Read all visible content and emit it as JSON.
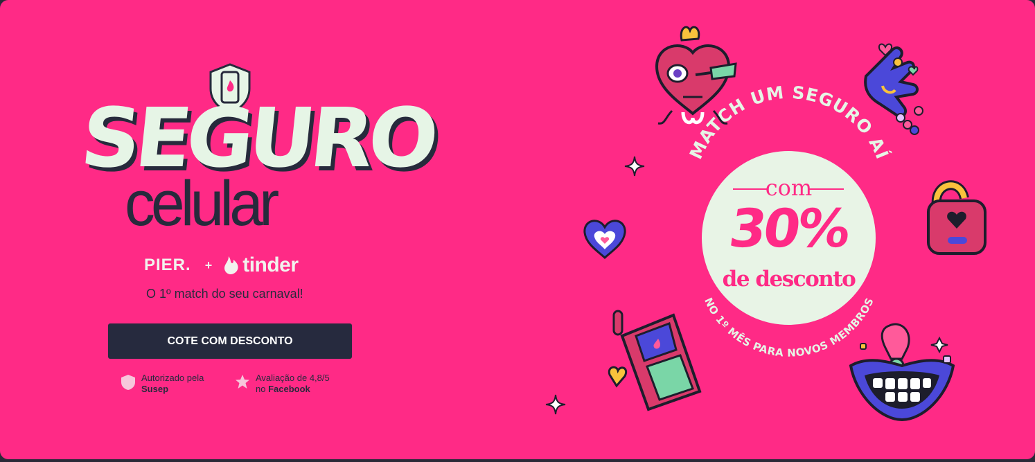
{
  "hero": {
    "title_top": "SEGURO",
    "title_bottom": "celular",
    "brand_pier": "PIER.",
    "brand_plus": "+",
    "brand_tinder": "tinder",
    "tagline": "O 1º match do seu carnaval!",
    "cta_label": "COTE COM DESCONTO"
  },
  "badges": [
    {
      "icon": "shield-icon",
      "line1": "Autorizado pela",
      "line2": "Susep"
    },
    {
      "icon": "star-icon",
      "line1": "Avaliação de 4,8/5",
      "line2_prefix": "no ",
      "line2": "Facebook"
    }
  ],
  "promo": {
    "arc_top": "MATCH UM SEGURO AÍ",
    "com": "com",
    "percent": "30%",
    "desc": "de desconto",
    "arc_bottom": "NO 1º MÊS PARA NOVOS MEMBROS"
  },
  "colors": {
    "background": "#ff2a86",
    "dark": "#262a3e",
    "mint": "#e6f5e6"
  },
  "stickers": [
    "heart-arrow-sticker",
    "hand-gesture-sticker",
    "padlock-sticker",
    "blue-heart-sticker",
    "phone-sticker",
    "lips-sticker",
    "sparkle-icon"
  ]
}
